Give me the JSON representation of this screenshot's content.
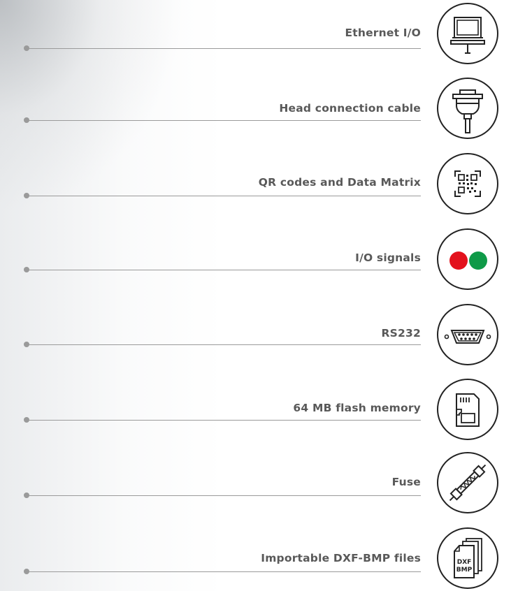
{
  "features": [
    {
      "label": "Ethernet I/O",
      "icon": "computer-icon"
    },
    {
      "label": "Head connection cable",
      "icon": "cable-connector-icon"
    },
    {
      "label": "QR codes and Data Matrix",
      "icon": "qr-code-icon"
    },
    {
      "label": "I/O signals",
      "icon": "red-green-signal-icon"
    },
    {
      "label": "RS232",
      "icon": "rs232-port-icon"
    },
    {
      "label": "64 MB flash memory",
      "icon": "sd-card-icon"
    },
    {
      "label": "Fuse",
      "icon": "fuse-icon"
    },
    {
      "label": "Importable DXF-BMP files",
      "icon": "file-stack-icon"
    }
  ],
  "file_icon_text": [
    "DXF",
    "BMP"
  ],
  "colors": {
    "signal_red": "#e3121d",
    "signal_green": "#0f9a48",
    "line": "#9a9a9a",
    "text": "#595959"
  }
}
